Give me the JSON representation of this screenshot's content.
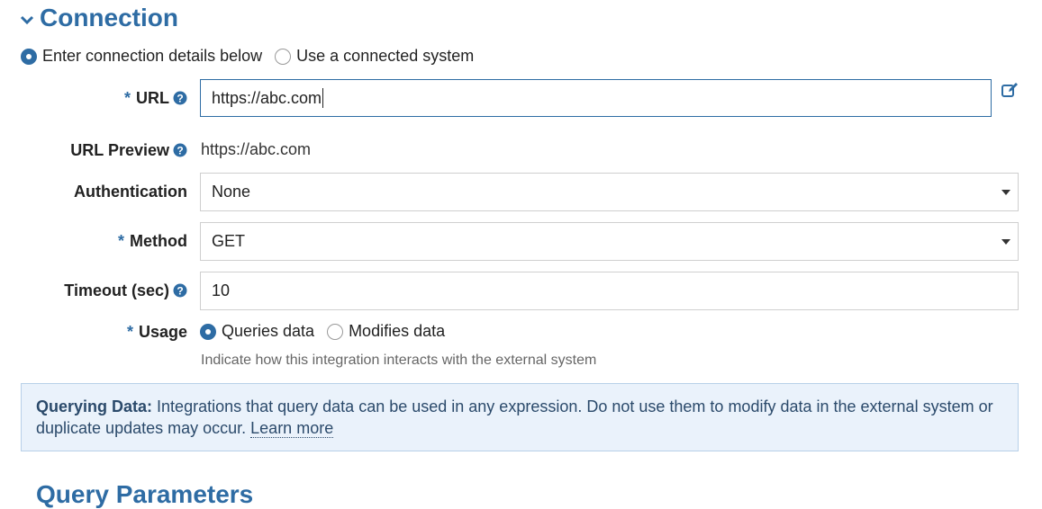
{
  "section": {
    "title": "Connection"
  },
  "connection_mode": {
    "options": [
      {
        "label": "Enter connection details below",
        "selected": true
      },
      {
        "label": "Use a connected system",
        "selected": false
      }
    ]
  },
  "form": {
    "url": {
      "label": "URL",
      "value": "https://abc.com"
    },
    "url_preview": {
      "label": "URL Preview",
      "value": "https://abc.com"
    },
    "authentication": {
      "label": "Authentication",
      "value": "None"
    },
    "method": {
      "label": "Method",
      "value": "GET"
    },
    "timeout": {
      "label": "Timeout (sec)",
      "value": "10"
    },
    "usage": {
      "label": "Usage",
      "options": [
        {
          "label": "Queries data",
          "selected": true
        },
        {
          "label": "Modifies data",
          "selected": false
        }
      ],
      "hint": "Indicate how this integration interacts with the external system"
    }
  },
  "banner": {
    "heading": "Querying Data:",
    "text": "Integrations that query data can be used in any expression. Do not use them to modify data in the external system or duplicate updates may occur.",
    "link": "Learn more"
  },
  "next_section": {
    "title": "Query Parameters"
  },
  "colors": {
    "accent": "#2e6ca4",
    "banner_bg": "#eaf2fb"
  },
  "icons": [
    "chevron-down-icon",
    "help-icon",
    "edit-icon",
    "dropdown-caret-icon"
  ]
}
